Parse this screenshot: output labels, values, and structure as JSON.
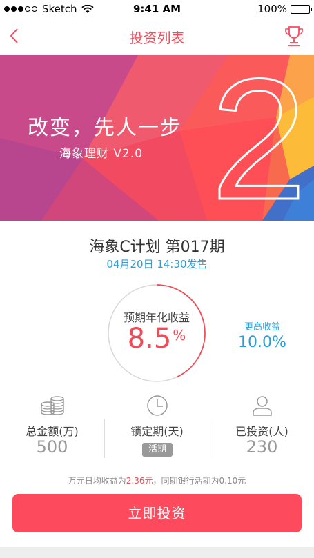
{
  "status_bar": {
    "carrier": "Sketch",
    "time": "9:41 AM",
    "battery": "100%"
  },
  "nav": {
    "title": "投资列表",
    "back_icon": "chevron-left-icon",
    "trophy_icon": "trophy-icon"
  },
  "banner": {
    "slogan": "改变，先人一步",
    "subtitle": "海象理财 V2.0",
    "big_number": "2"
  },
  "product": {
    "name": "海象C计划  第017期",
    "sale_time": "04月20日 14:30发售"
  },
  "rate": {
    "label": "预期年化收益",
    "value": "8.5",
    "unit": "%",
    "higher_label": "更高收益",
    "higher_value": "10.0%"
  },
  "stats": [
    {
      "icon": "coins-icon",
      "label": "总金额(万)",
      "value": "500"
    },
    {
      "icon": "clock-icon",
      "label": "锁定期(天)",
      "badge": "活期"
    },
    {
      "icon": "user-icon",
      "label": "已投资(人)",
      "value": "230"
    }
  ],
  "earnings_note": {
    "prefix": "万元日均收益为",
    "amount": "2.36元",
    "suffix": "，同期银行活期为0.10元"
  },
  "cta": {
    "label": "立即投资"
  },
  "colors": {
    "accent": "#fd4a5c",
    "link_blue": "#2a9fd8",
    "muted": "#999999"
  }
}
